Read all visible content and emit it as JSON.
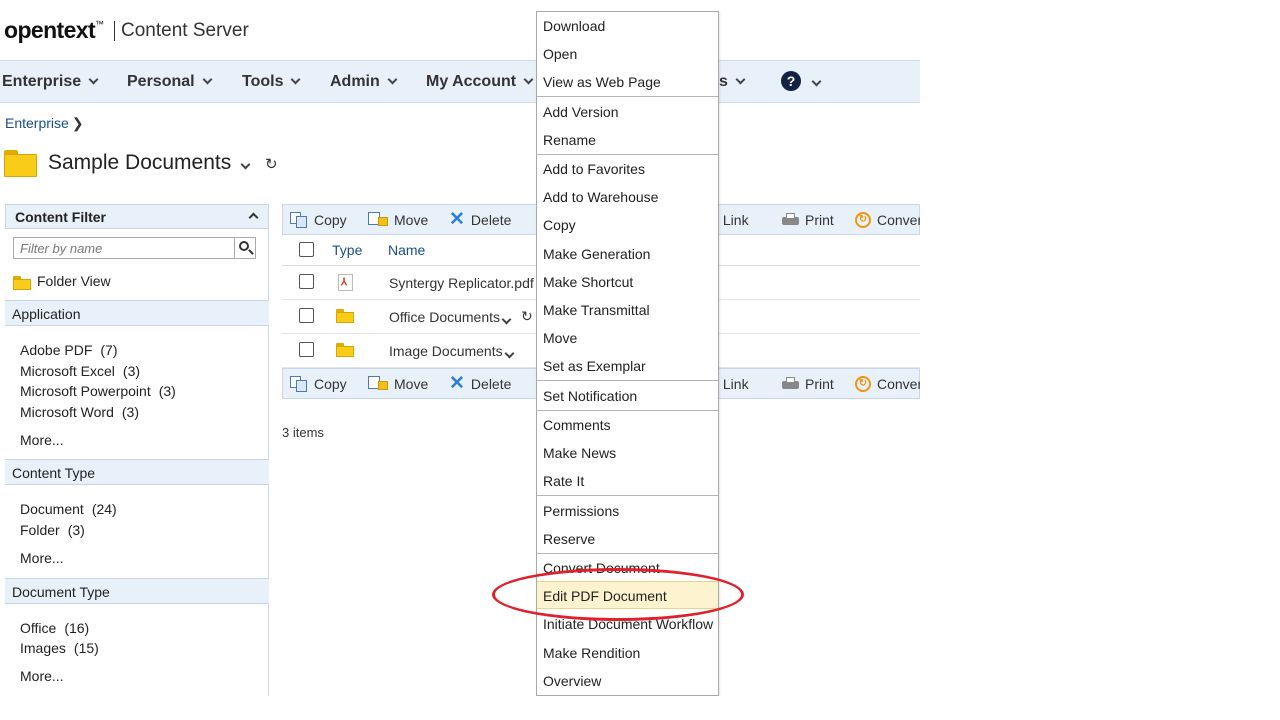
{
  "header": {
    "brand": "opentext",
    "brand_tm": "™",
    "product": "Content Server"
  },
  "nav": {
    "items": [
      "Enterprise",
      "Personal",
      "Tools",
      "Admin",
      "My Account",
      "s"
    ],
    "help": "?"
  },
  "breadcrumb": {
    "items": [
      "Enterprise"
    ],
    "separator": "❯"
  },
  "page": {
    "title": "Sample Documents",
    "refresh_glyph": "↻"
  },
  "sidebar": {
    "header": "Content Filter",
    "filter_placeholder": "Filter by name",
    "folder_view": "Folder View",
    "sections": [
      {
        "title": "Application",
        "facets": [
          {
            "label": "Adobe PDF",
            "count": "(7)"
          },
          {
            "label": "Microsoft Excel",
            "count": "(3)"
          },
          {
            "label": "Microsoft Powerpoint",
            "count": "(3)"
          },
          {
            "label": "Microsoft Word",
            "count": "(3)"
          }
        ],
        "more": "More..."
      },
      {
        "title": "Content Type",
        "facets": [
          {
            "label": "Document",
            "count": "(24)"
          },
          {
            "label": "Folder",
            "count": "(3)"
          }
        ],
        "more": "More..."
      },
      {
        "title": "Document Type",
        "facets": [
          {
            "label": "Office",
            "count": "(16)"
          },
          {
            "label": "Images",
            "count": "(15)"
          }
        ],
        "more": "More..."
      }
    ]
  },
  "toolbar": {
    "copy": "Copy",
    "move": "Move",
    "delete": "Delete",
    "email": "ail Link",
    "print": "Print",
    "convert": "Conver"
  },
  "table": {
    "col_type": "Type",
    "col_name": "Name",
    "rows": [
      {
        "name": "Syntergy Replicator.pdf",
        "kind": "pdf"
      },
      {
        "name": "Office Documents",
        "kind": "folder"
      },
      {
        "name": "Image Documents",
        "kind": "folder"
      }
    ]
  },
  "item_count": "3 items",
  "context_menu": {
    "items": [
      "Download",
      "Open",
      "View as Web Page",
      "Add Version",
      "Rename",
      "Add to Favorites",
      "Add to Warehouse",
      "Copy",
      "Make Generation",
      "Make Shortcut",
      "Make Transmittal",
      "Move",
      "Set as Exemplar",
      "Set Notification",
      "Comments",
      "Make News",
      "Rate It",
      "Permissions",
      "Reserve",
      "Convert Document",
      "Edit PDF Document",
      "Initiate Document Workflow",
      "Make Rendition",
      "Overview"
    ],
    "highlighted": "Edit PDF Document"
  },
  "colors": {
    "nav_bg": "#e8f1fa",
    "link": "#1a4f8a",
    "highlight_bg": "#fdf3cf",
    "annotation": "#e0202a"
  }
}
